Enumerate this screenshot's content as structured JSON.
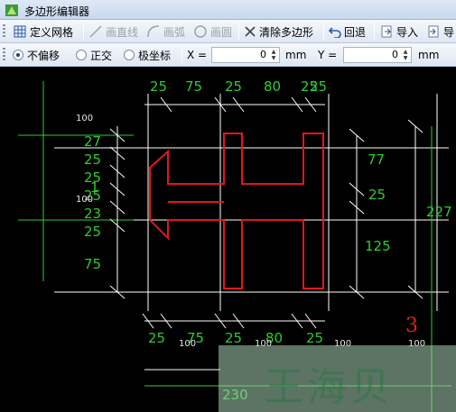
{
  "window": {
    "title": "多边形编辑器"
  },
  "toolbar1": {
    "define_grid": "定义网格",
    "draw_line": "画直线",
    "draw_arc": "画弧",
    "draw_circle": "画圆",
    "clear_polygon": "清除多边形",
    "undo": "回退",
    "import": "导入",
    "export": "导"
  },
  "toolbar2": {
    "mode_no_offset": "不偏移",
    "mode_orthogonal": "正交",
    "mode_polar": "极坐标",
    "x_label": "X =",
    "x_value": "0",
    "x_unit": "mm",
    "y_label": "Y =",
    "y_value": "0",
    "y_unit": "mm"
  },
  "canvas": {
    "top_dims": [
      "25",
      "75",
      "25",
      "80",
      "25",
      "25"
    ],
    "bottom_dims": [
      "25",
      "75",
      "25",
      "80",
      "25"
    ],
    "left_dims": [
      "27",
      "25",
      "25",
      "23",
      "25",
      "75"
    ],
    "left_extra": "1",
    "right_dims": [
      "77",
      "25",
      "125",
      "227"
    ],
    "grid_labels": [
      "100",
      "100",
      "100",
      "100",
      "100",
      "100"
    ],
    "total_width": "230",
    "section_number": "3"
  },
  "watermark": "王海贝",
  "colors": {
    "dimension": "#2ecc2e",
    "polygon": "#e01818",
    "grid": "#ffffff",
    "background": "#000000"
  }
}
